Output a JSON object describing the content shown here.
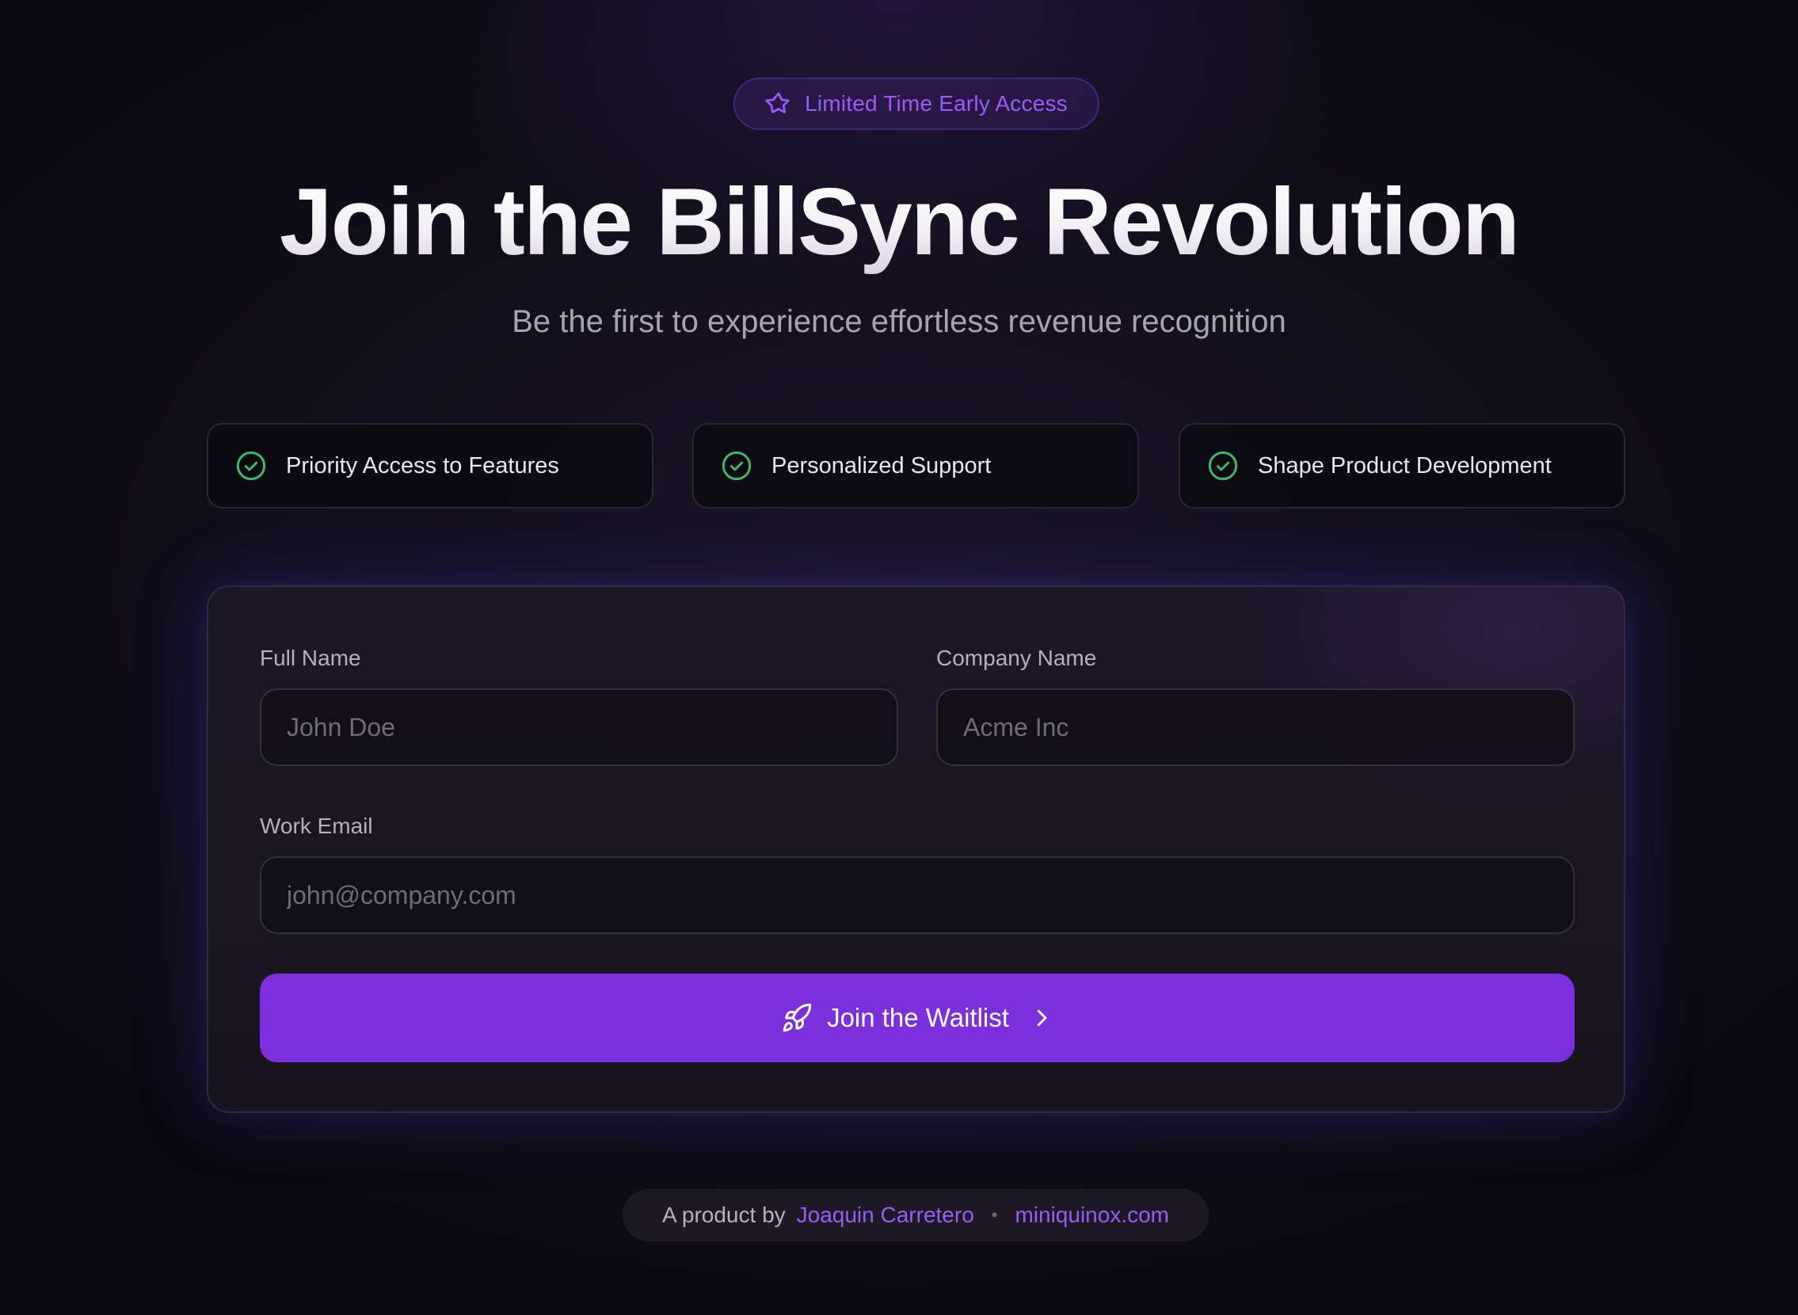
{
  "badge": {
    "icon": "star-icon",
    "label": "Limited Time Early Access"
  },
  "hero": {
    "title": "Join the BillSync Revolution",
    "subtitle": "Be the first to experience effortless revenue recognition"
  },
  "features": [
    {
      "icon": "check-circle-icon",
      "label": "Priority Access to Features"
    },
    {
      "icon": "check-circle-icon",
      "label": "Personalized Support"
    },
    {
      "icon": "check-circle-icon",
      "label": "Shape Product Development"
    }
  ],
  "form": {
    "full_name": {
      "label": "Full Name",
      "value": "",
      "placeholder": "John Doe"
    },
    "company_name": {
      "label": "Company Name",
      "value": "",
      "placeholder": "Acme Inc"
    },
    "work_email": {
      "label": "Work Email",
      "value": "",
      "placeholder": "john@company.com"
    },
    "submit": {
      "label": "Join the Waitlist",
      "icon": "rocket-icon",
      "trailing_icon": "chevron-right-icon"
    }
  },
  "footer": {
    "prefix": "A product by",
    "author": "Joaquin Carretero",
    "separator": "•",
    "site": "miniquinox.com"
  },
  "colors": {
    "accent": "#7c2fdd",
    "accent_text": "#9b5cf6",
    "check": "#3fb86a",
    "background": "#120f1d"
  }
}
